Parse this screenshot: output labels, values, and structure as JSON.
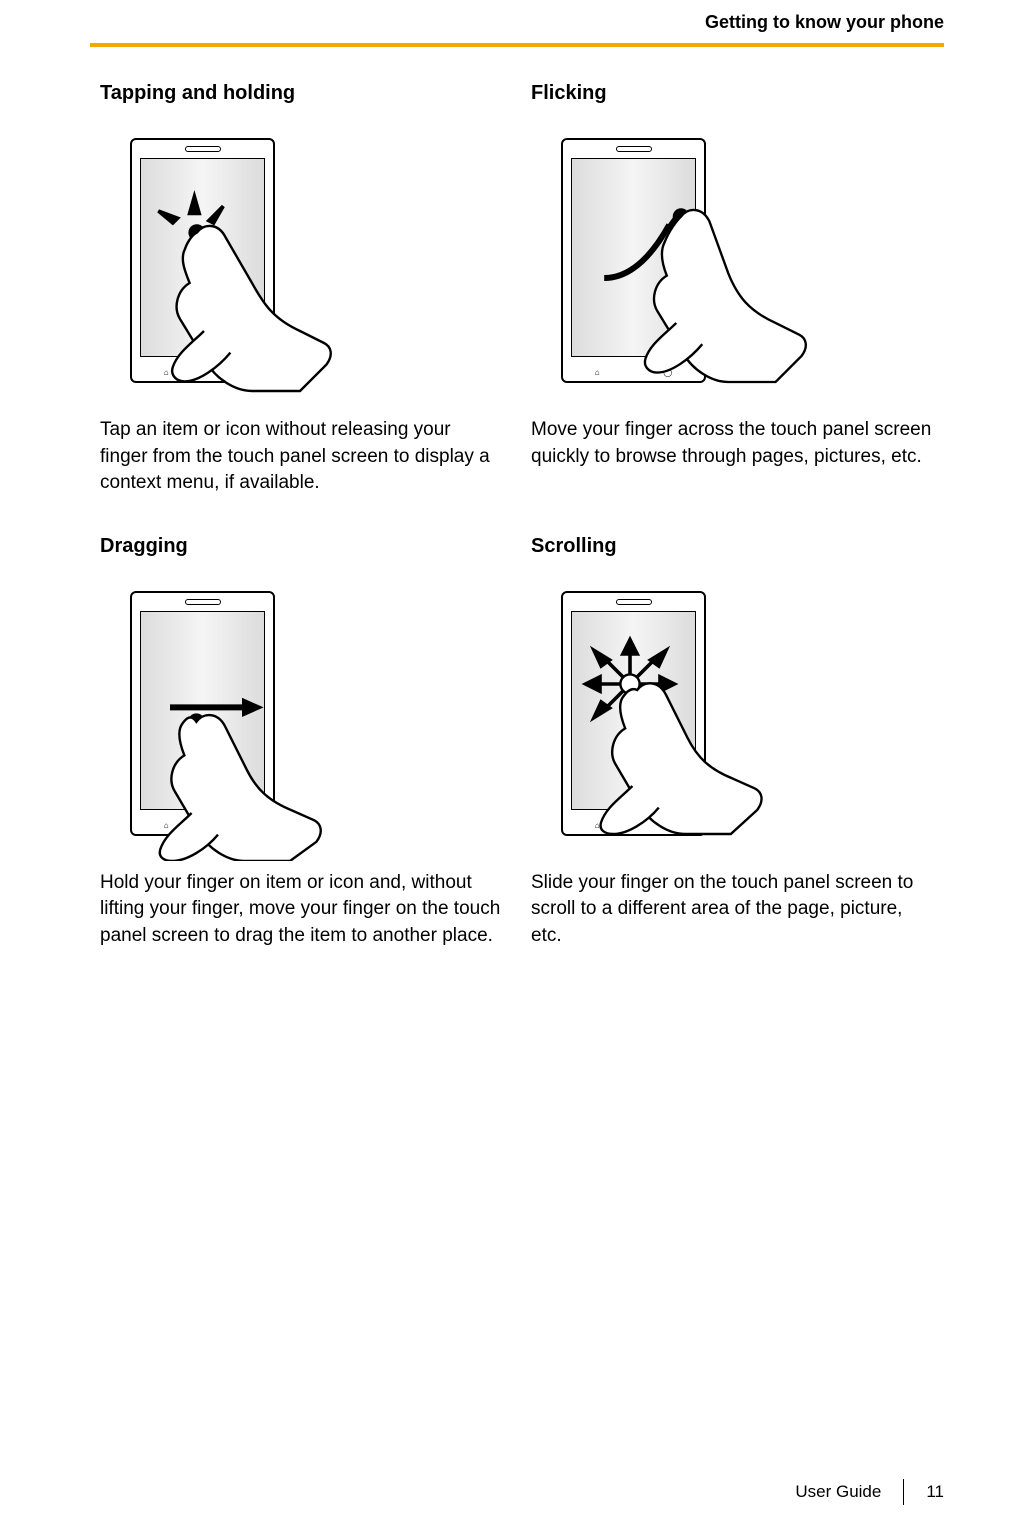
{
  "header": {
    "title": "Getting to know your phone"
  },
  "sections": {
    "tap_hold": {
      "title": "Tapping and holding",
      "desc": "Tap an item or icon without releasing your finger from the touch panel screen to display a context menu, if available."
    },
    "flicking": {
      "title": "Flicking",
      "desc": "Move your finger across the touch panel screen quickly to browse through pages, pictures, etc."
    },
    "dragging": {
      "title": "Dragging",
      "desc": "Hold your finger on item or icon and, without lifting your finger, move your finger on the touch panel screen to drag the item to another place."
    },
    "scrolling": {
      "title": "Scrolling",
      "desc": "Slide your finger on the touch panel screen to scroll to a different area of the page, picture, etc."
    }
  },
  "footer": {
    "label": "User Guide",
    "page": "11"
  }
}
